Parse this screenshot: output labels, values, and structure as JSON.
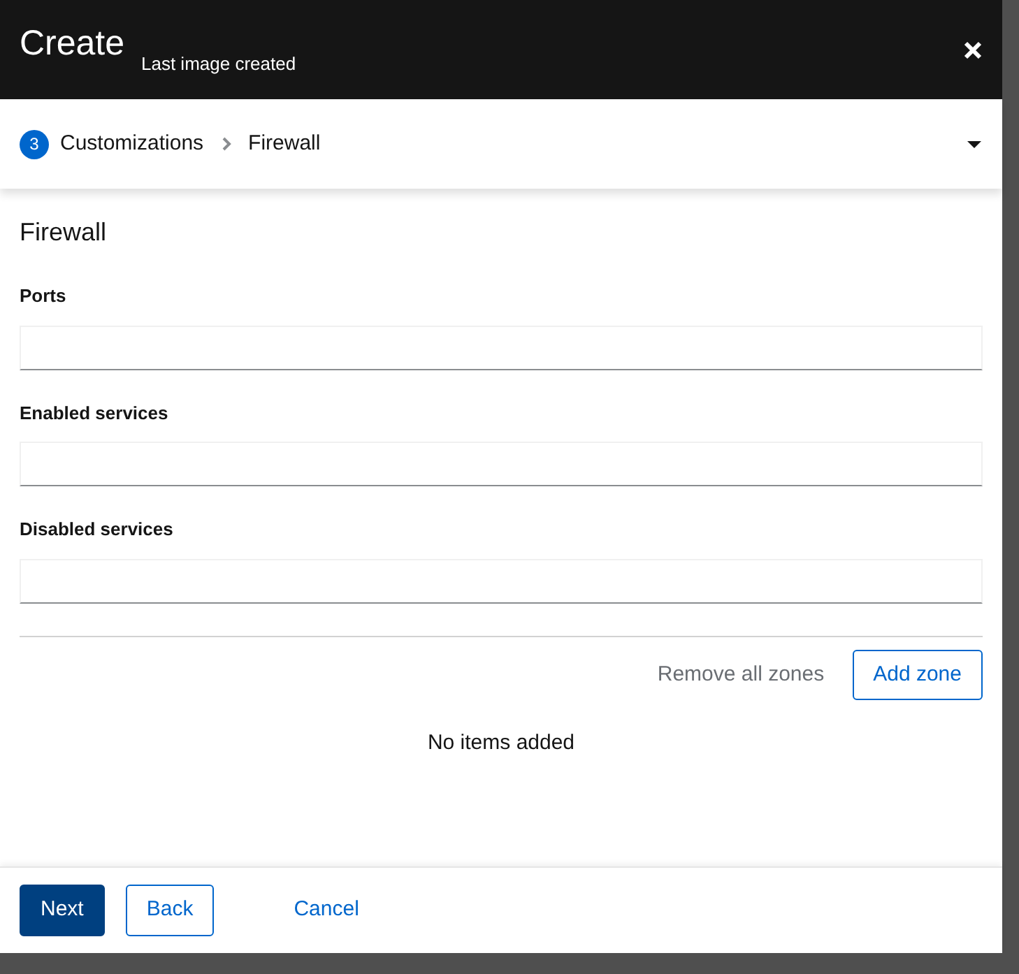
{
  "modal": {
    "title": "Create",
    "tooltip": "Last image created"
  },
  "breadcrumb": {
    "step_number": "3",
    "items": [
      "Customizations",
      "Firewall"
    ],
    "expanded": false
  },
  "section_title": "Firewall",
  "fields": [
    {
      "label": "Ports"
    },
    {
      "label": "Enabled services"
    },
    {
      "label": "Disabled services"
    }
  ],
  "zones": {
    "remove_all": "Remove all zones",
    "remove_all_disabled": true,
    "add": "Add zone",
    "empty_text": "No items added"
  },
  "footer_buttons": [
    {
      "label": "Next",
      "kind": "primary"
    },
    {
      "label": "Back",
      "kind": "secondary"
    },
    {
      "label": "Cancel",
      "kind": "link"
    }
  ]
}
